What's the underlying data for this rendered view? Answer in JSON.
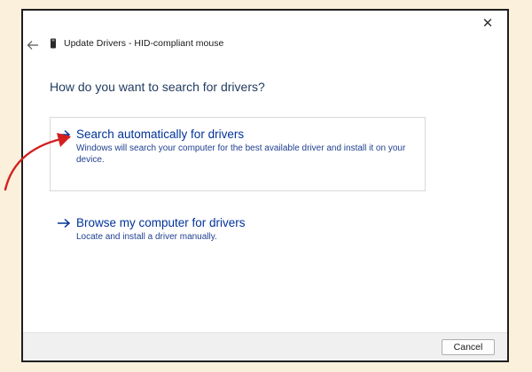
{
  "dialog": {
    "title": "Update Drivers - HID-compliant mouse",
    "heading": "How do you want to search for drivers?",
    "options": [
      {
        "title": "Search automatically for drivers",
        "description": "Windows will search your computer for the best available driver and install it on your device."
      },
      {
        "title": "Browse my computer for drivers",
        "description": "Locate and install a driver manually."
      }
    ],
    "cancel_label": "Cancel"
  },
  "icons": {
    "close": "close-icon",
    "back": "back-arrow-icon",
    "device": "device-icon",
    "option_arrow": "arrow-right-icon",
    "annotation": "annotation-arrow"
  },
  "colors": {
    "link": "#003399",
    "annotation": "#d41f1f",
    "background": "#fbf0dc"
  }
}
